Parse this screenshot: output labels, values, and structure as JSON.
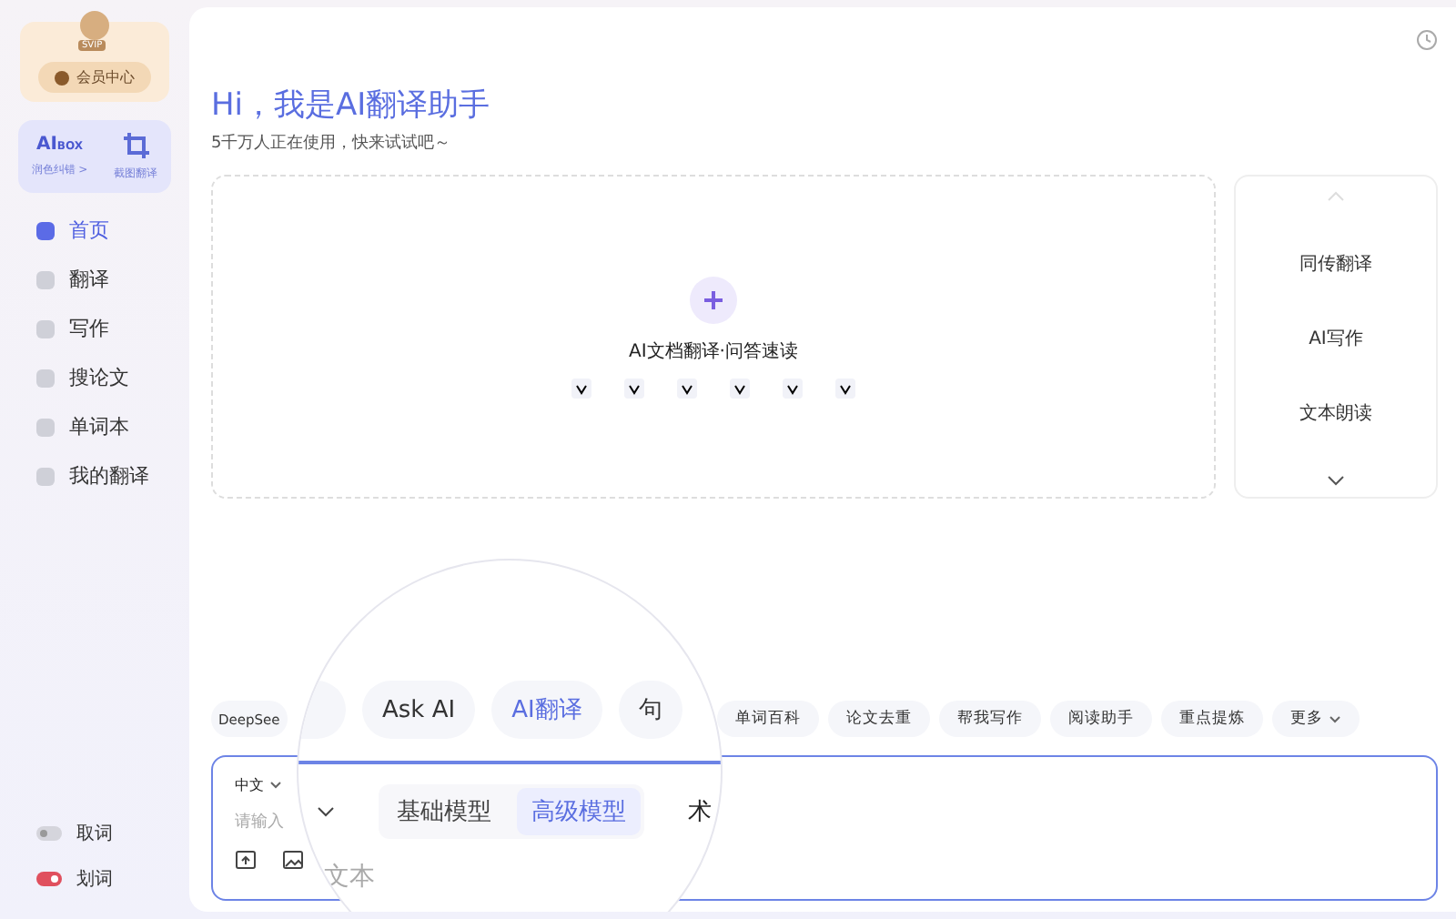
{
  "sidebar": {
    "vip": {
      "badge": "SVIP",
      "button": "会员中心"
    },
    "toolbox": {
      "logo_main": "AI",
      "logo_sub": "BOX",
      "link": "润色纠错 >",
      "screenshot": "截图翻译"
    },
    "nav": [
      {
        "label": "首页",
        "selected": true
      },
      {
        "label": "翻译",
        "selected": false
      },
      {
        "label": "写作",
        "selected": false
      },
      {
        "label": "搜论文",
        "selected": false
      },
      {
        "label": "单词本",
        "selected": false
      },
      {
        "label": "我的翻译",
        "selected": false
      }
    ],
    "toggles": [
      {
        "label": "取词",
        "on": false
      },
      {
        "label": "划词",
        "on": true
      }
    ]
  },
  "main": {
    "title": "Hi，我是AI翻译助手",
    "subtitle": "5千万人正在使用，快来试试吧～",
    "upload": {
      "label": "AI文档翻译·问答速读"
    },
    "side_card": {
      "items": [
        "同传翻译",
        "AI写作",
        "文本朗读"
      ]
    },
    "chips": [
      {
        "label": "DeepSee",
        "kind": "plain"
      },
      {
        "label": "单词百科",
        "kind": "plain"
      },
      {
        "label": "论文去重",
        "kind": "plain"
      },
      {
        "label": "帮我写作",
        "kind": "plain"
      },
      {
        "label": "阅读助手",
        "kind": "plain"
      },
      {
        "label": "重点提炼",
        "kind": "plain"
      },
      {
        "label": "更多",
        "kind": "menu"
      }
    ],
    "input": {
      "language": "中文",
      "placeholder": "请输入"
    },
    "magnifier": {
      "chips": [
        {
          "label": "Ask AI",
          "selected": false
        },
        {
          "label": "AI翻译",
          "selected": true
        },
        {
          "label": "句",
          "selected": false
        }
      ],
      "model_tabs": [
        {
          "label": "基础模型",
          "selected": false
        },
        {
          "label": "高级模型",
          "selected": true
        }
      ],
      "trailing": "术",
      "placeholder_part": "文本"
    }
  }
}
